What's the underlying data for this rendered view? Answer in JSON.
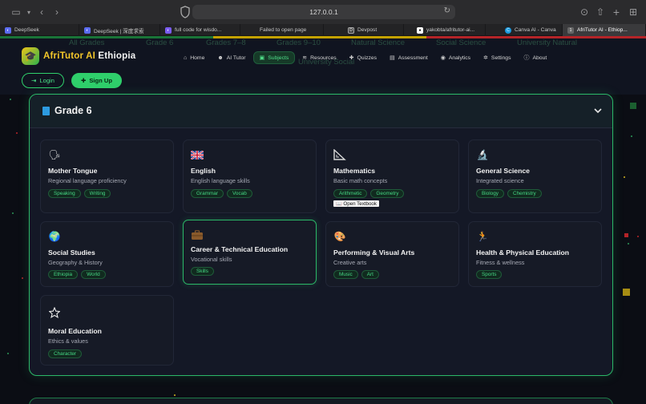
{
  "browser": {
    "url": "127.0.0.1",
    "tabs": [
      {
        "label": "DeepSeek",
        "color": "#5b6cf0"
      },
      {
        "label": "DeepSeek | 深度求索",
        "color": "#5b6cf0"
      },
      {
        "label": "full code for wisdo...",
        "color": "#7a5cf0"
      },
      {
        "label": "Failed to open page",
        "color": ""
      },
      {
        "label": "Devpost",
        "color": "#2a2a2a"
      },
      {
        "label": "yakobta/afritutor-ai...",
        "color": "#ffffff"
      },
      {
        "label": "Canva AI - Canva",
        "color": "#1b9be0"
      },
      {
        "label": "AfriTutor AI - Ethiop...",
        "color": "#5b5b5b",
        "active": true
      }
    ]
  },
  "brand": {
    "name_part1": "AfriTutor AI",
    "name_part2": " Ethiopia",
    "logo_icon": "graduation-cap-icon"
  },
  "nav": [
    {
      "label": "Home",
      "icon": "home-icon",
      "glyph": "⌂"
    },
    {
      "label": "AI Tutor",
      "icon": "robot-icon",
      "glyph": "☻"
    },
    {
      "label": "Subjects",
      "icon": "book-icon",
      "glyph": "▣",
      "active": true
    },
    {
      "label": "Resources",
      "icon": "layers-icon",
      "glyph": "≋"
    },
    {
      "label": "Quizzes",
      "icon": "puzzle-icon",
      "glyph": "✚"
    },
    {
      "label": "Assessment",
      "icon": "chart-icon",
      "glyph": "▤"
    },
    {
      "label": "Analytics",
      "icon": "globe-icon",
      "glyph": "◉"
    },
    {
      "label": "Settings",
      "icon": "gear-icon",
      "glyph": "✲"
    },
    {
      "label": "About",
      "icon": "info-icon",
      "glyph": "ⓘ"
    }
  ],
  "auth": {
    "login": "Login",
    "signup": "Sign Up"
  },
  "ghost_filters": [
    "All Grades",
    "Grade 6",
    "Grades 7–8",
    "Grades 9–10",
    "Natural Science",
    "Social Science",
    "University Natural",
    "University Social"
  ],
  "grade": {
    "title": "Grade 6",
    "subjects": [
      {
        "title": "Mother Tongue",
        "subtitle": "Regional language proficiency",
        "icon": "speaking-head-icon",
        "glyph": "🗣",
        "tags": [
          "Speaking",
          "Writing"
        ]
      },
      {
        "title": "English",
        "subtitle": "English language skills",
        "icon": "uk-flag-icon",
        "glyph": "🇬🇧",
        "tags": [
          "Grammar",
          "Vocab"
        ]
      },
      {
        "title": "Mathematics",
        "subtitle": "Basic math concepts",
        "icon": "triangle-ruler-icon",
        "glyph": "📐",
        "tags": [
          "Arithmetic",
          "Geometry"
        ],
        "open_textbook": "📖 Open Textbook"
      },
      {
        "title": "General Science",
        "subtitle": "Integrated science",
        "icon": "microscope-icon",
        "glyph": "🔬",
        "tags": [
          "Biology",
          "Chemistry"
        ]
      },
      {
        "title": "Social Studies",
        "subtitle": "Geography & History",
        "icon": "globe-icon",
        "glyph": "🌍",
        "tags": [
          "Ethiopia",
          "World"
        ]
      },
      {
        "title": "Career & Technical Education",
        "subtitle": "Vocational skills",
        "icon": "briefcase-icon",
        "glyph": "💼",
        "tags": [
          "Skills"
        ],
        "highlight": true
      },
      {
        "title": "Performing & Visual Arts",
        "subtitle": "Creative arts",
        "icon": "palette-icon",
        "glyph": "🎨",
        "tags": [
          "Music",
          "Art"
        ]
      },
      {
        "title": "Health & Physical Education",
        "subtitle": "Fitness & wellness",
        "icon": "running-icon",
        "glyph": "🏃",
        "tags": [
          "Sports"
        ]
      },
      {
        "title": "Moral Education",
        "subtitle": "Ethics & values",
        "icon": "star-icon",
        "glyph": "☆",
        "tags": [
          "Character"
        ]
      }
    ]
  }
}
